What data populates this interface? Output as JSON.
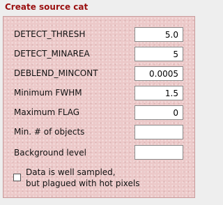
{
  "title": "Create source cat",
  "fields": [
    {
      "label": "DETECT_THRESH",
      "value": "5.0"
    },
    {
      "label": "DETECT_MINAREA",
      "value": "5"
    },
    {
      "label": "DEBLEND_MINCONT",
      "value": "0.0005"
    },
    {
      "label": "Minimum FWHM",
      "value": "1.5"
    },
    {
      "label": "Maximum FLAG",
      "value": "0"
    },
    {
      "label": "Min. # of objects",
      "value": ""
    },
    {
      "label": "Background level",
      "value": ""
    }
  ],
  "checkbox": {
    "checked": false,
    "label_line1": "Data is well sampled,",
    "label_line2": "but plagued with hot pixels"
  },
  "colors": {
    "title": "#9a1010",
    "panel_background": "#ecc9c9",
    "window_background": "#eeeeee"
  }
}
